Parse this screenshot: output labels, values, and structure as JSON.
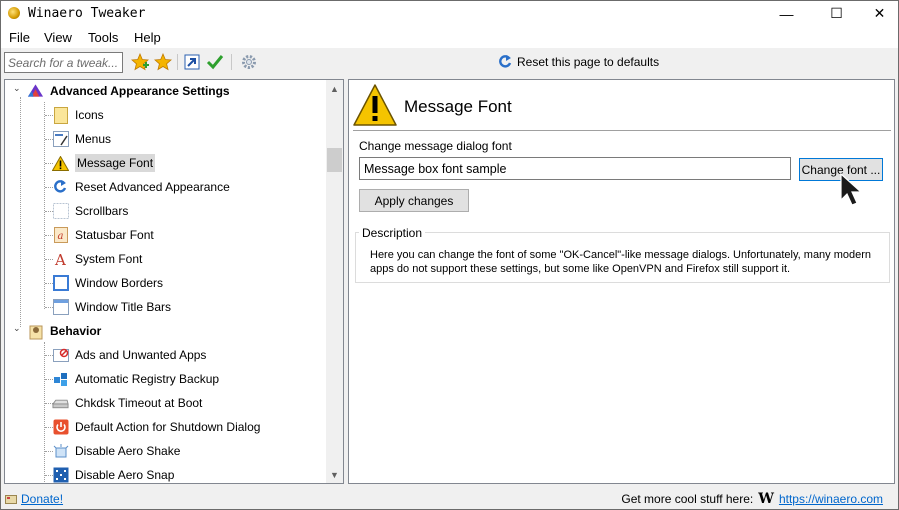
{
  "window": {
    "title": "Winaero Tweaker",
    "controls": {
      "minimize": "—",
      "maximize": "☐",
      "close": "✕"
    }
  },
  "menu": [
    "File",
    "View",
    "Tools",
    "Help"
  ],
  "toolbar": {
    "search_placeholder": "Search for a tweak...",
    "reset_label": "Reset this page to defaults"
  },
  "tree": {
    "groups": [
      {
        "label": "Advanced Appearance Settings",
        "expander": "⌄",
        "items": [
          {
            "label": "Icons"
          },
          {
            "label": "Menus"
          },
          {
            "label": "Message Font",
            "selected": true
          },
          {
            "label": "Reset Advanced Appearance"
          },
          {
            "label": "Scrollbars"
          },
          {
            "label": "Statusbar Font"
          },
          {
            "label": "System Font"
          },
          {
            "label": "Window Borders"
          },
          {
            "label": "Window Title Bars"
          }
        ]
      },
      {
        "label": "Behavior",
        "expander": "⌄",
        "items": [
          {
            "label": "Ads and Unwanted Apps"
          },
          {
            "label": "Automatic Registry Backup"
          },
          {
            "label": "Chkdsk Timeout at Boot"
          },
          {
            "label": "Default Action for Shutdown Dialog"
          },
          {
            "label": "Disable Aero Shake"
          },
          {
            "label": "Disable Aero Snap"
          }
        ]
      }
    ]
  },
  "page": {
    "title": "Message Font",
    "field_label": "Change message dialog font",
    "sample_value": "Message box font sample",
    "change_font_button": "Change font ...",
    "apply_button": "Apply changes",
    "description_legend": "Description",
    "description_text": "Here you can change the font of some \"OK-Cancel\"-like message dialogs. Unfortunately, many modern apps do not support these settings, but some like OpenVPN and Firefox still support it."
  },
  "status": {
    "donate": "Donate!",
    "promo": "Get more cool stuff here:",
    "logo": "W",
    "url": "https://winaero.com"
  },
  "colors": {
    "link": "#0066cc",
    "warning": "#f5c400",
    "selection": "#d9d9d9"
  }
}
